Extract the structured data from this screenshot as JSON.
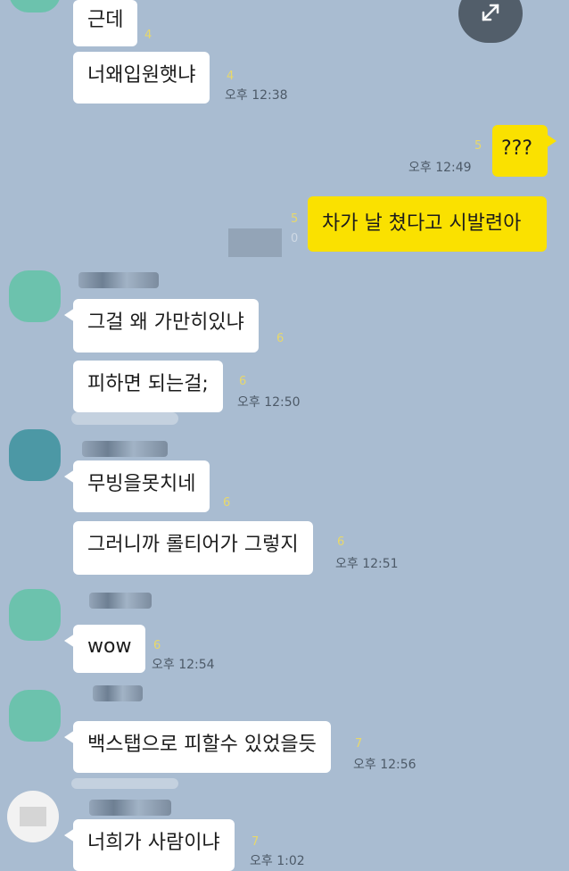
{
  "theme": {
    "background": "#a9bcd1",
    "my_bubble": "#fae100",
    "their_bubble": "#ffffff",
    "avatar_colors": [
      "#6cc2ad",
      "#4c98a5",
      "#6cc2ad",
      "#6cc2ad",
      "#f2f2f2"
    ]
  },
  "controls": {
    "expand_icon": "expand-arrows-icon"
  },
  "messages": [
    {
      "text": "근데",
      "read": "4"
    },
    {
      "text": "너왜입원햇냐",
      "read": "4",
      "time": "오후 12:38"
    },
    {
      "text": "???",
      "read": "5",
      "time": "오후 12:49"
    },
    {
      "text": "차가 날 쳤다고 시발련아",
      "read": "5",
      "unread_extra": "0"
    },
    {
      "text": "그걸 왜 가만히있냐",
      "read": "6"
    },
    {
      "text": "피하면 되는걸;",
      "read": "6",
      "time": "오후 12:50"
    },
    {
      "text": "무빙을못치네",
      "read": "6"
    },
    {
      "text": "그러니까 롤티어가 그렇지",
      "read": "6",
      "time": "오후 12:51"
    },
    {
      "text": "wow",
      "read": "6",
      "time": "오후 12:54"
    },
    {
      "text": "백스탭으로 피할수 있었을듯",
      "read": "7",
      "time": "오후 12:56"
    },
    {
      "text": "너희가 사람이냐",
      "read": "7",
      "time": "오후 1:02"
    }
  ]
}
